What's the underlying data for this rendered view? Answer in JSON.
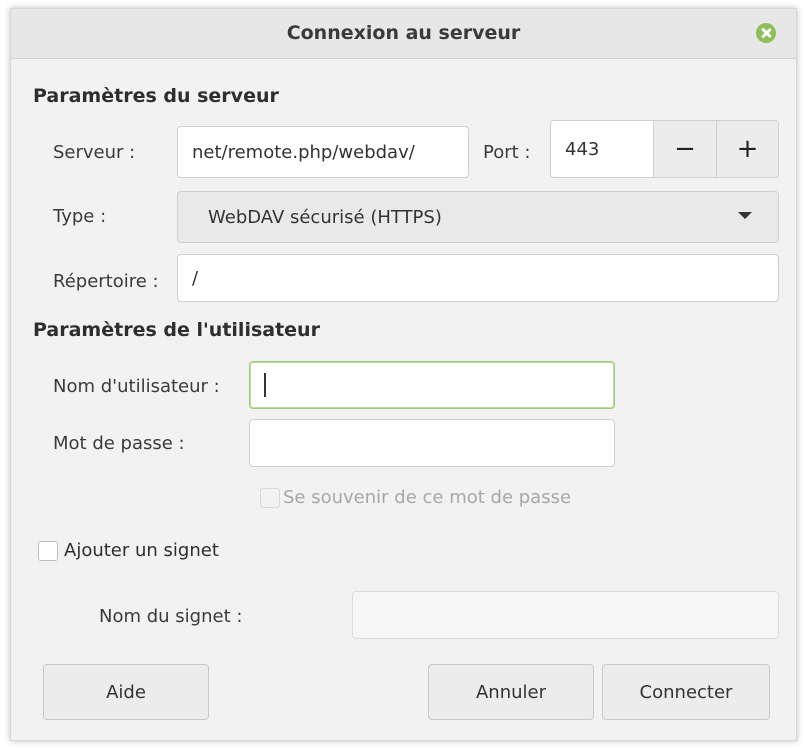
{
  "window": {
    "title": "Connexion au serveur",
    "close_icon": "close-icon",
    "accent_color": "#8fbf5a"
  },
  "server_section": {
    "title": "Paramètres du serveur",
    "server_label": "Serveur :",
    "server_value": "net/remote.php/webdav/",
    "port_label": "Port :",
    "port_value": "443",
    "minus_label": "−",
    "plus_label": "+",
    "type_label": "Type :",
    "type_value": "WebDAV sécurisé (HTTPS)",
    "directory_label": "Répertoire :",
    "directory_value": "/"
  },
  "user_section": {
    "title": "Paramètres de l'utilisateur",
    "username_label": "Nom d'utilisateur :",
    "username_value": "",
    "password_label": "Mot de passe :",
    "password_value": "",
    "remember_label": "Se souvenir de ce mot de passe"
  },
  "bookmark": {
    "add_label": "Ajouter un signet",
    "name_label": "Nom du signet :",
    "name_value": ""
  },
  "buttons": {
    "help": "Aide",
    "cancel": "Annuler",
    "connect": "Connecter"
  }
}
